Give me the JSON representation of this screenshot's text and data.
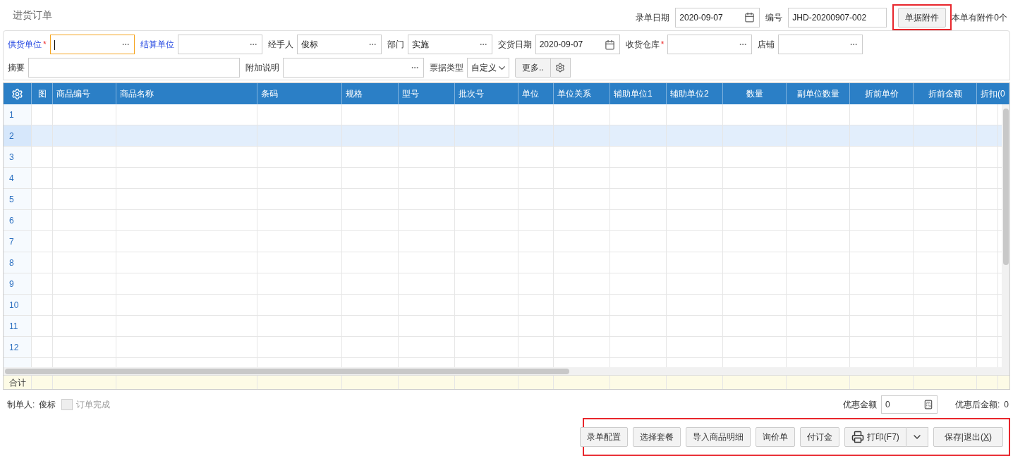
{
  "title": "进货订单",
  "header_fields": [
    {
      "label": "录单日期",
      "kind": "date",
      "value": "2020-09-07"
    },
    {
      "label": "编号",
      "kind": "text",
      "value": "JHD-20200907-002"
    }
  ],
  "attachment": {
    "button": "单据附件",
    "highlighted": true,
    "note": "本单有附件0个"
  },
  "required_mark": "*",
  "form_rows": [
    [
      {
        "label": "供货单位",
        "link": true,
        "required": true,
        "kind": "lookup",
        "focused": true
      },
      {
        "label": "结算单位",
        "link": true,
        "required": false,
        "kind": "lookup",
        "focused": false
      },
      {
        "label": "经手人",
        "link": false,
        "required": false,
        "kind": "lookup",
        "value": "俊标",
        "focused": false
      },
      {
        "label": "部门",
        "link": false,
        "required": false,
        "kind": "lookup",
        "value": "实施",
        "focused": false
      },
      {
        "label": "交货日期",
        "link": false,
        "required": false,
        "kind": "date",
        "value": "2020-09-07",
        "focused": false
      },
      {
        "label": "收货仓库",
        "link": false,
        "required": true,
        "kind": "lookup",
        "focused": false
      },
      {
        "label": "店铺",
        "link": false,
        "required": false,
        "kind": "lookup",
        "focused": false
      }
    ],
    [
      {
        "label": "摘要",
        "link": false,
        "required": false,
        "kind": "text",
        "focused": false
      },
      {
        "label": "附加说明",
        "link": false,
        "required": false,
        "kind": "lookup",
        "focused": false
      },
      {
        "label": "票据类型",
        "link": false,
        "required": false,
        "kind": "select",
        "value": "自定义",
        "focused": false
      }
    ]
  ],
  "more_button": "更多..",
  "table": {
    "columns": [
      "图",
      "商品编号",
      "商品名称",
      "条码",
      "规格",
      "型号",
      "批次号",
      "单位",
      "单位关系",
      "辅助单位1",
      "辅助单位2",
      "数量",
      "副单位数量",
      "折前单价",
      "折前金额",
      "折扣(0"
    ],
    "rows": [
      {
        "no": "1",
        "selected": false
      },
      {
        "no": "2",
        "selected": true
      },
      {
        "no": "3",
        "selected": false
      },
      {
        "no": "4",
        "selected": false
      },
      {
        "no": "5",
        "selected": false
      },
      {
        "no": "6",
        "selected": false
      },
      {
        "no": "7",
        "selected": false
      },
      {
        "no": "8",
        "selected": false
      },
      {
        "no": "9",
        "selected": false
      },
      {
        "no": "10",
        "selected": false
      },
      {
        "no": "11",
        "selected": false
      },
      {
        "no": "12",
        "selected": false
      }
    ],
    "total_label": "合计"
  },
  "creator": {
    "label": "制单人:",
    "value": "俊标"
  },
  "order_done": {
    "label": "订单完成",
    "checked": false,
    "disabled": true
  },
  "discount": {
    "label": "优惠金额",
    "value": "0"
  },
  "after_discount": {
    "label": "优惠后金额:",
    "value": "0"
  },
  "actions": {
    "highlighted": true,
    "buttons": [
      {
        "kind": "plain",
        "label": "录单配置"
      },
      {
        "kind": "plain",
        "label": "选择套餐"
      },
      {
        "kind": "plain",
        "label": "导入商品明细"
      },
      {
        "kind": "plain",
        "label": "询价单"
      },
      {
        "kind": "plain",
        "label": "付订金"
      },
      {
        "kind": "print",
        "label": "打印(F7)"
      },
      {
        "kind": "hotkey",
        "before": "保存|退出(",
        "key": "X",
        "after": ")"
      }
    ]
  }
}
